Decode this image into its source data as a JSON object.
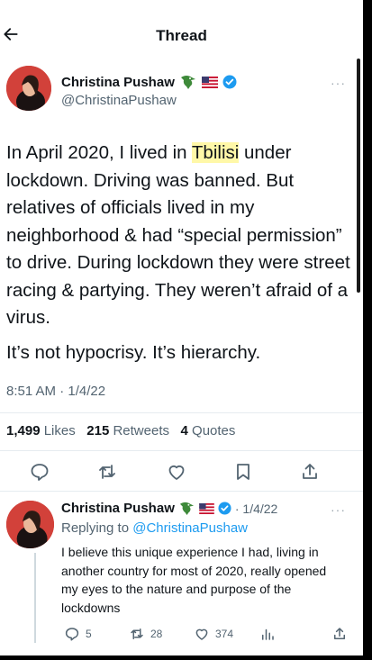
{
  "header": {
    "title": "Thread"
  },
  "tweet": {
    "author_name": "Christina Pushaw",
    "author_handle": "@ChristinaPushaw",
    "body_before_highlight": "In April 2020, I lived in ",
    "body_highlight": "Tbilisi",
    "body_after_highlight": " under lockdown. Driving was banned. But relatives of officials lived in my neighborhood & had “special permission” to drive. During lockdown they were street racing & partying. They weren’t afraid of a virus.",
    "body_second": "It’s not hypocrisy. It’s hierarchy.",
    "timestamp": "8:51 AM · 1/4/22",
    "likes_count": "1,499",
    "likes_label": "Likes",
    "retweets_count": "215",
    "retweets_label": "Retweets",
    "quotes_count": "4",
    "quotes_label": "Quotes",
    "more": "···"
  },
  "reply": {
    "author_name": "Christina Pushaw",
    "date": "· 1/4/22",
    "replying_prefix": "Replying to ",
    "replying_handle": "@ChristinaPushaw",
    "body": "I believe this unique experience I had, living in another country for most of 2020, really opened my eyes to the nature and purpose of the lockdowns",
    "reply_count": "5",
    "retweet_count": "28",
    "like_count": "374",
    "more": "···"
  },
  "icons": {
    "back": "arrow-left-icon",
    "gator": "alligator-emoji-icon",
    "flag": "us-flag-icon",
    "verified": "verified-badge-icon",
    "reply": "reply-icon",
    "retweet": "retweet-icon",
    "like": "heart-icon",
    "bookmark": "bookmark-icon",
    "share": "share-icon",
    "analytics": "analytics-icon"
  },
  "colors": {
    "accent": "#1d9bf0",
    "text": "#0f1419",
    "secondary": "#536471",
    "highlight": "#fff8a8"
  }
}
